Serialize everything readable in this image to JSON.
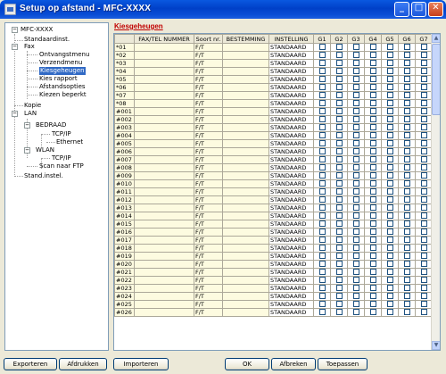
{
  "window": {
    "title": "Setup op afstand - MFC-XXXX",
    "minimize_glyph": "_",
    "maximize_glyph": "□",
    "close_glyph": "✕",
    "icon": "app-icon"
  },
  "tree": {
    "root": "MFC-XXXX",
    "standard": "Standaardinst.",
    "fax": "Fax",
    "receive_menu": "Ontvangstmenu",
    "send_menu": "Verzendmenu",
    "speed_dial": "Kiesgeheugen",
    "dial_report": "Kies rapport",
    "remote_options": "Afstandsopties",
    "dial_restriction": "Kiezen beperkt",
    "copy": "Kopie",
    "lan": "LAN",
    "wired": "BEDRAAD",
    "wired_tcpip": "TCP/IP",
    "ethernet": "Ethernet",
    "wlan": "WLAN",
    "wlan_tcpip": "TCP/IP",
    "scan_ftp": "Scan naar FTP",
    "stand_instel": "Stand.instel."
  },
  "panel": {
    "title": "Kiesgeheugen",
    "columns": [
      "",
      "FAX/TEL NUMMER",
      "Soort nr.",
      "BESTEMMING",
      "INSTELLING",
      "G1",
      "G2",
      "G3",
      "G4",
      "G5",
      "G6",
      "G7"
    ],
    "rows": [
      {
        "num": "*01",
        "type": "F/T",
        "setting": "STANDAARD"
      },
      {
        "num": "*02",
        "type": "F/T",
        "setting": "STANDAARD"
      },
      {
        "num": "*03",
        "type": "F/T",
        "setting": "STANDAARD"
      },
      {
        "num": "*04",
        "type": "F/T",
        "setting": "STANDAARD"
      },
      {
        "num": "*05",
        "type": "F/T",
        "setting": "STANDAARD"
      },
      {
        "num": "*06",
        "type": "F/T",
        "setting": "STANDAARD"
      },
      {
        "num": "*07",
        "type": "F/T",
        "setting": "STANDAARD"
      },
      {
        "num": "*08",
        "type": "F/T",
        "setting": "STANDAARD"
      },
      {
        "num": "#001",
        "type": "F/T",
        "setting": "STANDAARD"
      },
      {
        "num": "#002",
        "type": "F/T",
        "setting": "STANDAARD"
      },
      {
        "num": "#003",
        "type": "F/T",
        "setting": "STANDAARD"
      },
      {
        "num": "#004",
        "type": "F/T",
        "setting": "STANDAARD"
      },
      {
        "num": "#005",
        "type": "F/T",
        "setting": "STANDAARD"
      },
      {
        "num": "#006",
        "type": "F/T",
        "setting": "STANDAARD"
      },
      {
        "num": "#007",
        "type": "F/T",
        "setting": "STANDAARD"
      },
      {
        "num": "#008",
        "type": "F/T",
        "setting": "STANDAARD"
      },
      {
        "num": "#009",
        "type": "F/T",
        "setting": "STANDAARD"
      },
      {
        "num": "#010",
        "type": "F/T",
        "setting": "STANDAARD"
      },
      {
        "num": "#011",
        "type": "F/T",
        "setting": "STANDAARD"
      },
      {
        "num": "#012",
        "type": "F/T",
        "setting": "STANDAARD"
      },
      {
        "num": "#013",
        "type": "F/T",
        "setting": "STANDAARD"
      },
      {
        "num": "#014",
        "type": "F/T",
        "setting": "STANDAARD"
      },
      {
        "num": "#015",
        "type": "F/T",
        "setting": "STANDAARD"
      },
      {
        "num": "#016",
        "type": "F/T",
        "setting": "STANDAARD"
      },
      {
        "num": "#017",
        "type": "F/T",
        "setting": "STANDAARD"
      },
      {
        "num": "#018",
        "type": "F/T",
        "setting": "STANDAARD"
      },
      {
        "num": "#019",
        "type": "F/T",
        "setting": "STANDAARD"
      },
      {
        "num": "#020",
        "type": "F/T",
        "setting": "STANDAARD"
      },
      {
        "num": "#021",
        "type": "F/T",
        "setting": "STANDAARD"
      },
      {
        "num": "#022",
        "type": "F/T",
        "setting": "STANDAARD"
      },
      {
        "num": "#023",
        "type": "F/T",
        "setting": "STANDAARD"
      },
      {
        "num": "#024",
        "type": "F/T",
        "setting": "STANDAARD"
      },
      {
        "num": "#025",
        "type": "F/T",
        "setting": "STANDAARD"
      },
      {
        "num": "#026",
        "type": "F/T",
        "setting": "STANDAARD"
      }
    ],
    "scroll_up": "▲",
    "scroll_down": "▼"
  },
  "buttons": {
    "export": "Exporteren",
    "print": "Afdrukken",
    "import": "Importeren",
    "ok": "OK",
    "cancel": "Afbreken",
    "apply": "Toepassen"
  }
}
